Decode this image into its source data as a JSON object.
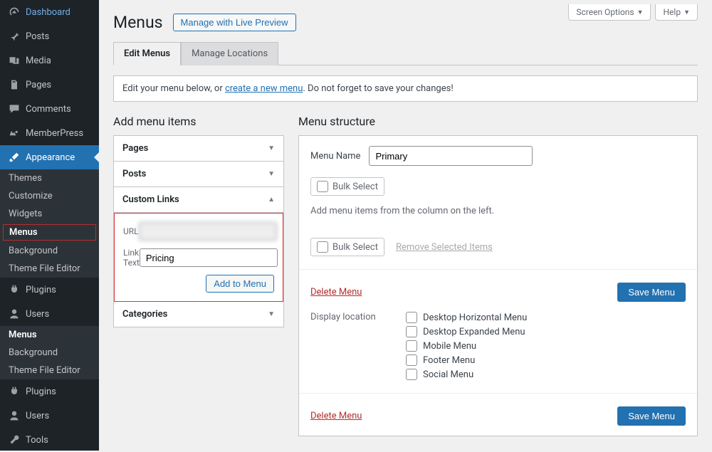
{
  "top_buttons": {
    "screen_options": "Screen Options",
    "help": "Help"
  },
  "sidebar": {
    "items": [
      {
        "label": "Dashboard"
      },
      {
        "label": "Posts"
      },
      {
        "label": "Media"
      },
      {
        "label": "Pages"
      },
      {
        "label": "Comments"
      },
      {
        "label": "MemberPress"
      },
      {
        "label": "Appearance"
      },
      {
        "label": "Plugins"
      },
      {
        "label": "Users"
      },
      {
        "label": "Plugins"
      },
      {
        "label": "Users"
      },
      {
        "label": "Tools"
      }
    ],
    "appearance_submenu": [
      {
        "label": "Themes"
      },
      {
        "label": "Customize"
      },
      {
        "label": "Widgets"
      },
      {
        "label": "Menus",
        "current": true
      },
      {
        "label": "Background"
      },
      {
        "label": "Theme File Editor"
      }
    ],
    "secondary_submenu": [
      {
        "label": "Menus"
      },
      {
        "label": "Background"
      },
      {
        "label": "Theme File Editor"
      }
    ]
  },
  "page": {
    "title": "Menus",
    "live_preview": "Manage with Live Preview",
    "tabs": {
      "edit": "Edit Menus",
      "locations": "Manage Locations"
    },
    "notice_pre": "Edit your menu below, or ",
    "notice_link": "create a new menu",
    "notice_post": ". Do not forget to save your changes!"
  },
  "add_items": {
    "heading": "Add menu items",
    "pages": "Pages",
    "posts": "Posts",
    "custom_links": "Custom Links",
    "categories": "Categories",
    "url_label": "URL",
    "url_value": "",
    "linktext_label": "Link Text",
    "linktext_value": "Pricing",
    "add_button": "Add to Menu"
  },
  "structure": {
    "heading": "Menu structure",
    "menu_name_label": "Menu Name",
    "menu_name_value": "Primary",
    "bulk_select": "Bulk Select",
    "hint": "Add menu items from the column on the left.",
    "remove_selected": "Remove Selected Items",
    "delete_menu": "Delete Menu",
    "save_menu": "Save Menu",
    "display_location_label": "Display location",
    "locations": [
      "Desktop Horizontal Menu",
      "Desktop Expanded Menu",
      "Mobile Menu",
      "Footer Menu",
      "Social Menu"
    ]
  }
}
